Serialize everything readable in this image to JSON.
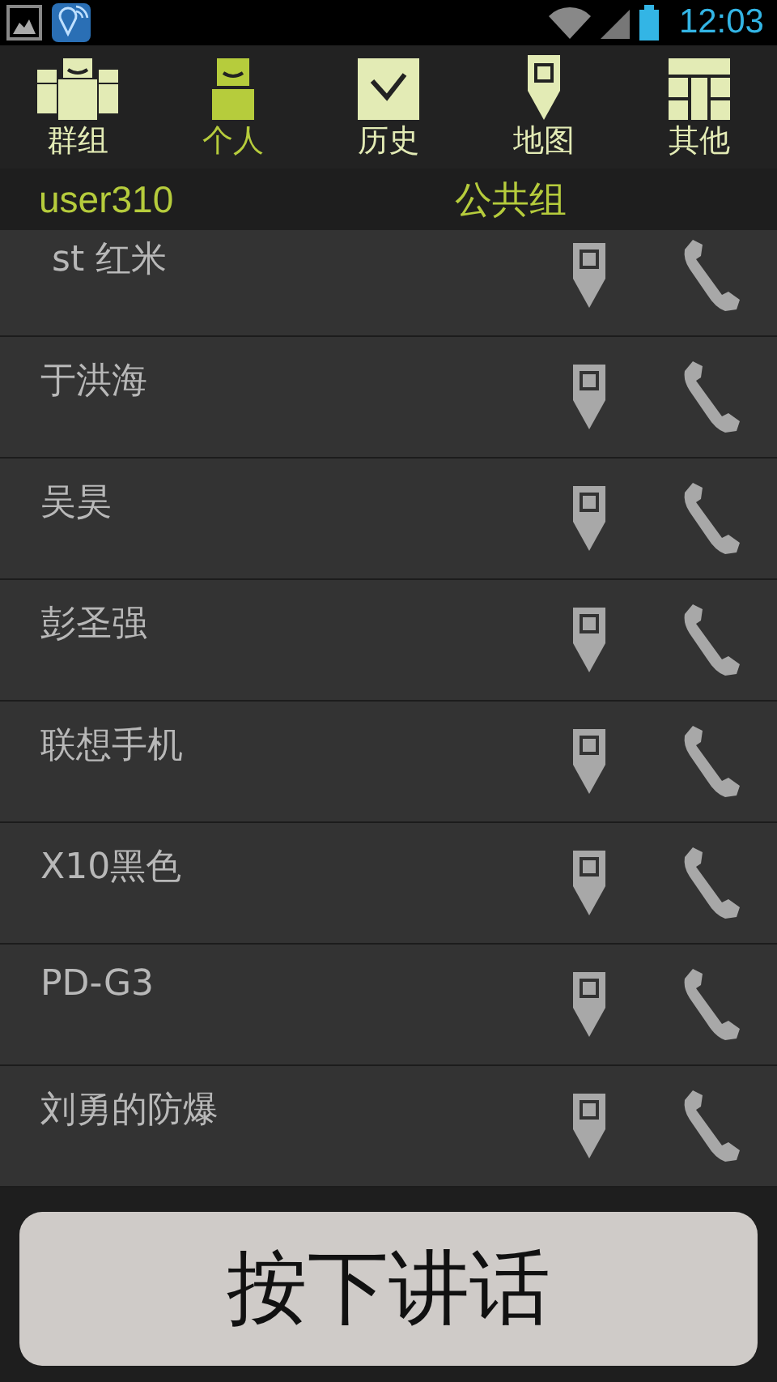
{
  "status_bar": {
    "time": "12:03"
  },
  "tabs": [
    {
      "label": "群组",
      "kind": "group",
      "selected": false
    },
    {
      "label": "个人",
      "kind": "person",
      "selected": true
    },
    {
      "label": "历史",
      "kind": "history",
      "selected": false
    },
    {
      "label": "地图",
      "kind": "map",
      "selected": false
    },
    {
      "label": "其他",
      "kind": "other",
      "selected": false
    }
  ],
  "header": {
    "user": "user310",
    "group": "公共组"
  },
  "contacts": [
    {
      "name": " st 红米"
    },
    {
      "name": "于洪海"
    },
    {
      "name": "吴昊"
    },
    {
      "name": "彭圣强"
    },
    {
      "name": "联想手机"
    },
    {
      "name": "X10黑色"
    },
    {
      "name": "PD-G3"
    },
    {
      "name": "刘勇的防爆"
    }
  ],
  "talk_button": "按下讲话"
}
